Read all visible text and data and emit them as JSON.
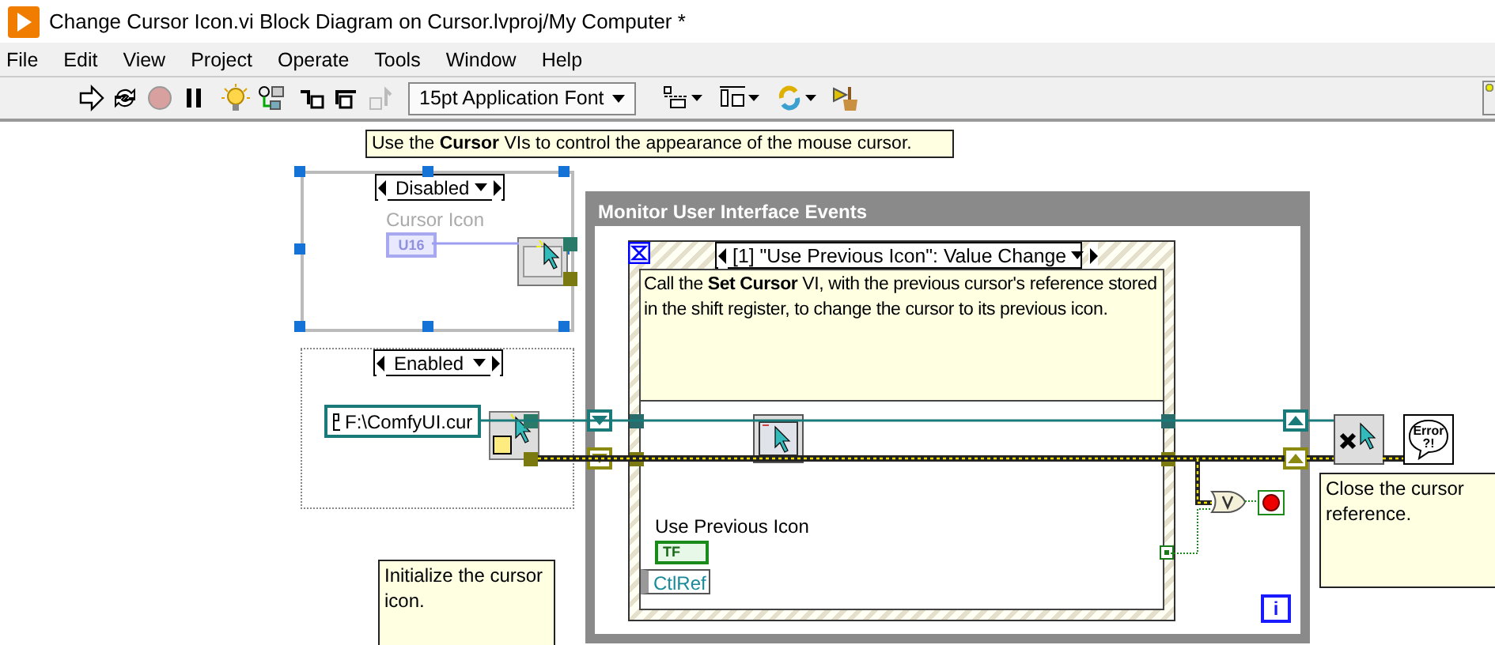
{
  "window": {
    "title": "Change Cursor Icon.vi Block Diagram on Cursor.lvproj/My Computer *"
  },
  "menu": [
    "File",
    "Edit",
    "View",
    "Project",
    "Operate",
    "Tools",
    "Window",
    "Help"
  ],
  "toolbar": {
    "font_menu": "15pt Application Font"
  },
  "diagram": {
    "comments": [
      {
        "kind": "top",
        "text": "Use the **Cursor** VIs to control the appearance of the mouse cursor."
      },
      {
        "kind": "init",
        "text": "Initialize the cursor icon."
      },
      {
        "kind": "close",
        "text": "Close the cursor reference."
      }
    ],
    "disable_structure": {
      "cases": [
        {
          "selector": "Disabled",
          "selected": true,
          "label": "Cursor Icon",
          "constant": "U16"
        },
        {
          "selector": "Enabled",
          "selected": false,
          "path": "F:\\ComfyUI.cur"
        }
      ]
    },
    "while_loop": {
      "label": "Monitor User Interface Events",
      "iteration": "i",
      "event_structure": {
        "selector": "[1] \"Use Previous Icon\": Value Change",
        "comment": "Call the **Set Cursor** VI, with the previous cursor's reference stored in the shift register, to change the cursor to its previous icon.",
        "control_label": "Use Previous Icon",
        "terminal": "TF",
        "ctlref": "CtlRef"
      }
    },
    "error_handler": {
      "lines": [
        "Error",
        "?!"
      ]
    }
  }
}
